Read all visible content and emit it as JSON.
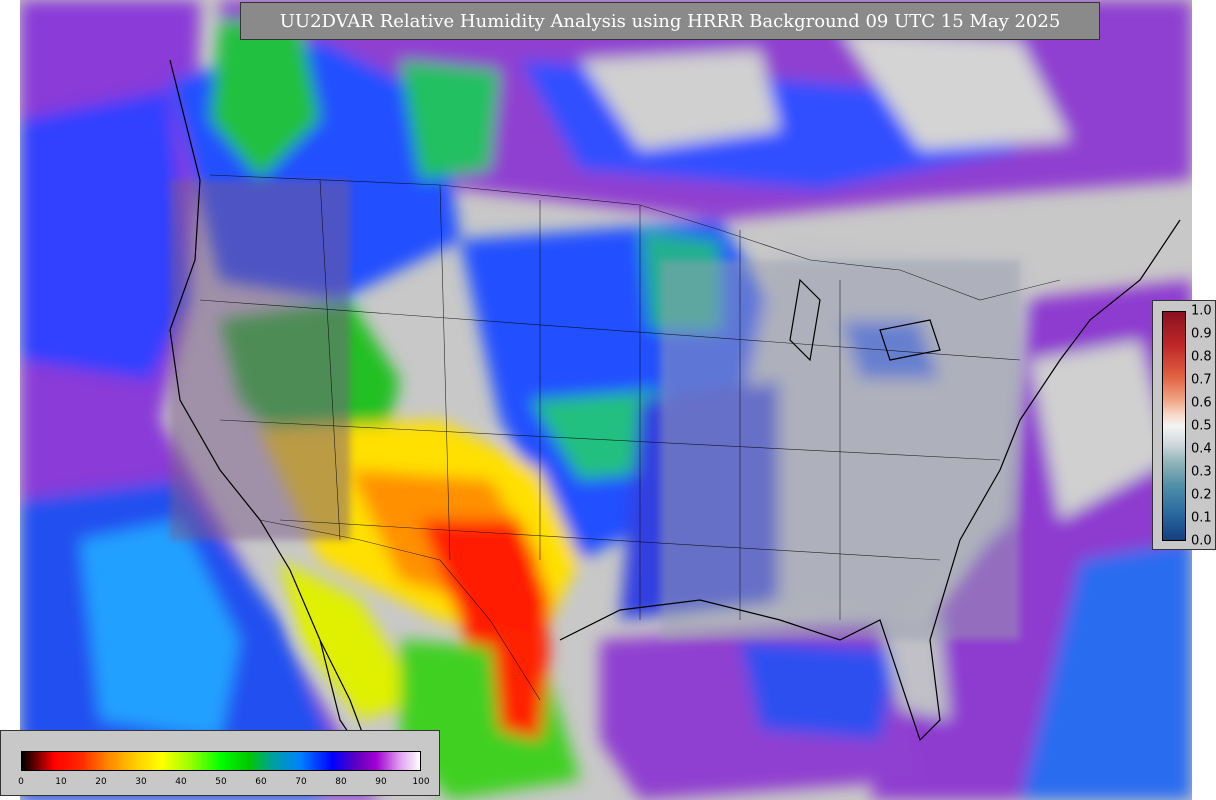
{
  "title": "UU2DVAR Relative Humidity Analysis using HRRR Background 09 UTC 15 May 2025",
  "rh_colorbar": {
    "ticks": [
      "0",
      "10",
      "20",
      "30",
      "40",
      "50",
      "60",
      "70",
      "80",
      "90",
      "100"
    ]
  },
  "obs_colorbar": {
    "ticks": [
      "1.0",
      "0.9",
      "0.8",
      "0.7",
      "0.6",
      "0.5",
      "0.4",
      "0.3",
      "0.2",
      "0.1",
      "0.0"
    ]
  },
  "colors": {
    "background_gray": "#c8c8c8",
    "title_box": "#8a8a8a",
    "humid_purple": "#8a2be2",
    "moist_blue": "#1e3cff",
    "dry_red": "#ff0000"
  }
}
